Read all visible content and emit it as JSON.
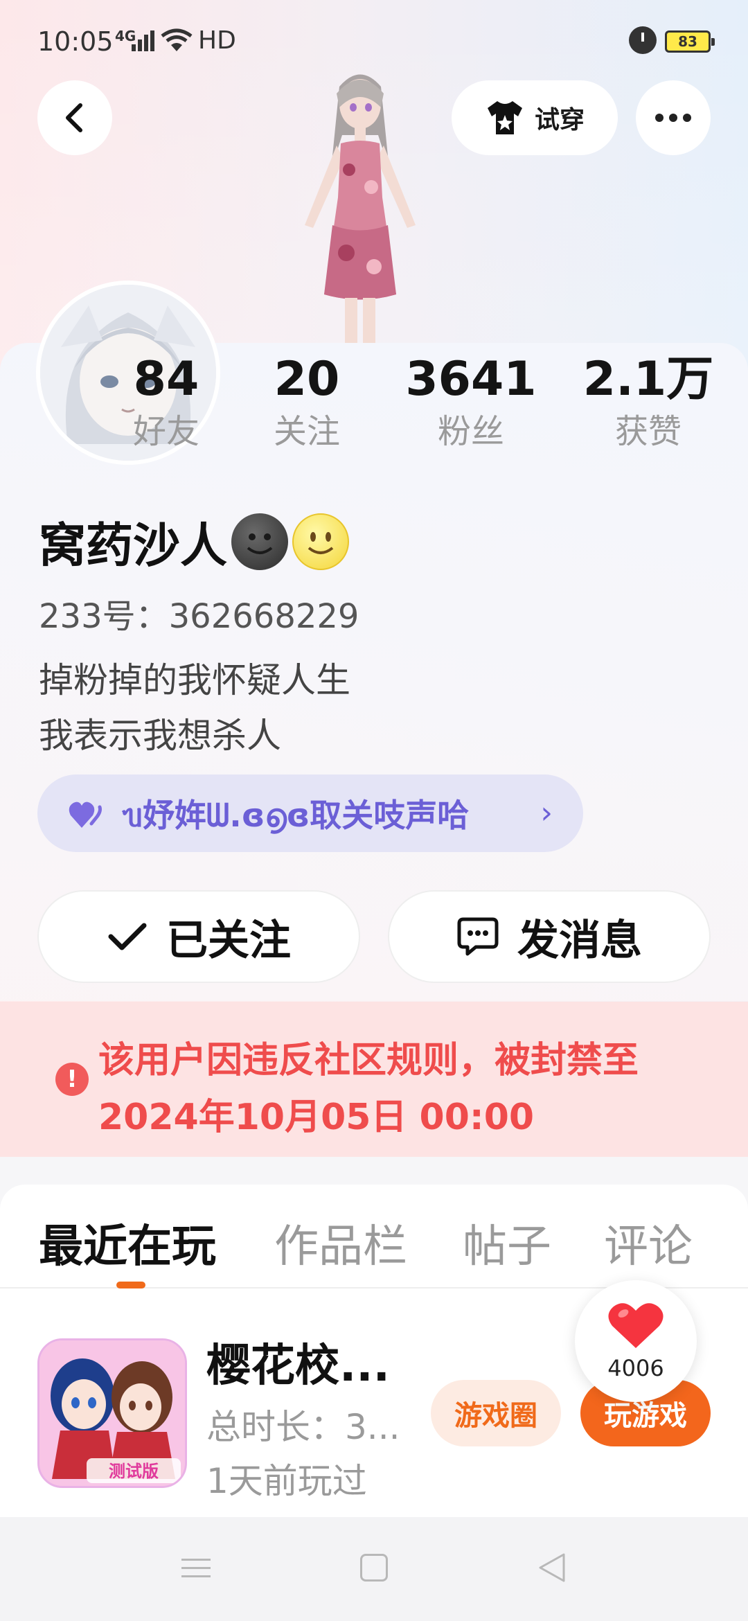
{
  "status_bar": {
    "time": "10:05",
    "network": "4G",
    "hd": "HD",
    "battery": "83"
  },
  "header": {
    "tryon_label": "试穿"
  },
  "stats": [
    {
      "value": "84",
      "label": "好友"
    },
    {
      "value": "20",
      "label": "关注"
    },
    {
      "value": "3641",
      "label": "粉丝"
    },
    {
      "value": "2.1万",
      "label": "获赞"
    }
  ],
  "profile": {
    "name": "窝药沙人",
    "uid": "233号：362668229",
    "bio_line1": "掉粉掉的我怀疑人生",
    "bio_line2": "我表示我想杀人",
    "group_text": "ᥔ妤姩ᗯ.ɞ൭ɞ取关吱声哈",
    "follow_label": "已关注",
    "message_label": "发消息"
  },
  "ban_notice": {
    "line1": "该用户因违反社区规则，被封禁至",
    "line2": "2024年10月05日 00:00"
  },
  "tabs": [
    "最近在玩",
    "作品栏",
    "帖子",
    "评论"
  ],
  "game": {
    "title": "樱花校...",
    "duration": "总时长：3...",
    "last_played": "1天前玩过",
    "badge": "测试版",
    "circle_label": "游戏圈",
    "play_label": "玩游戏",
    "like_count": "4006"
  },
  "colors": {
    "accent": "#f3661c",
    "ban_red": "#ef4c4c",
    "group_purple": "#6b5fd6"
  }
}
